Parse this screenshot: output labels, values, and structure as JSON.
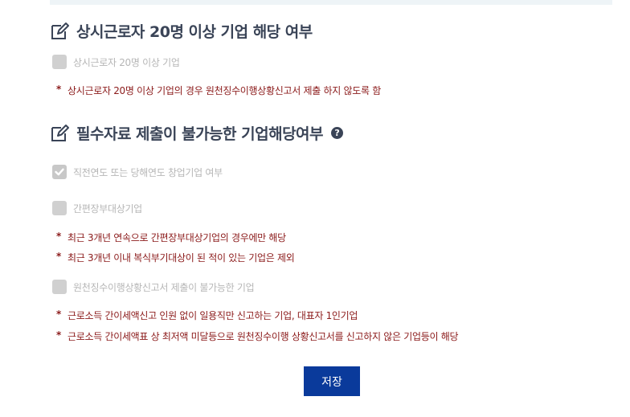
{
  "section1": {
    "title": "상시근로자 20명 이상 기업 해당 여부",
    "checkbox": {
      "label": "상시근로자 20명 이상 기업",
      "checked": false
    },
    "notes": [
      "상시근로자 20명 이상 기업의 경우 원천징수이행상황신고서 제출 하지 않도록 함"
    ]
  },
  "section2": {
    "title": "필수자료 제출이 불가능한 기업해당여부",
    "help_glyph": "?",
    "items": [
      {
        "label": "직전연도 또는 당해연도 창업기업 여부",
        "checked": true,
        "notes": []
      },
      {
        "label": "간편장부대상기업",
        "checked": false,
        "notes": [
          "최근 3개년 연속으로 간편장부대상기업의 경우에만 해당",
          "최근 3개년 이내 복식부기대상이 된 적이 있는 기업은 제외"
        ]
      },
      {
        "label": "원천징수이행상황신고서 제출이 불가능한 기업",
        "checked": false,
        "notes": [
          "근로소득 간이세액신고 인원 없이 일용직만 신고하는 기업, 대표자 1인기업",
          "근로소득 간이세액표 상 최저액 미달등으로 원천징수이행 상황신고서를 신고하지 않은 기업등이 해당"
        ]
      }
    ]
  },
  "note_marker": "*",
  "save_label": "저장"
}
